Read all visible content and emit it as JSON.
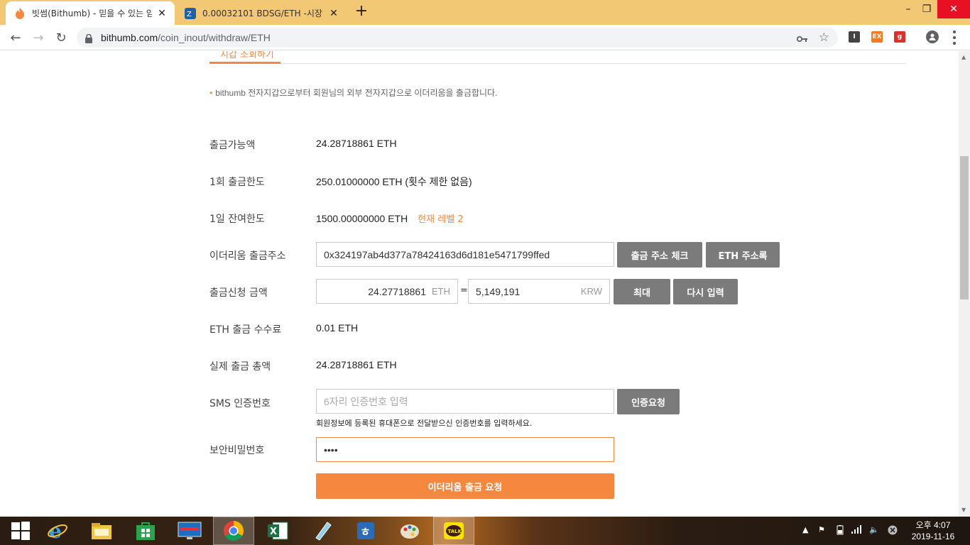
{
  "browser": {
    "tabs": [
      {
        "title": "빗썸(Bithumb) - 믿을 수 있는 암",
        "active": true
      },
      {
        "title": "0.00032101 BDSG/ETH -시장 동",
        "active": false
      }
    ],
    "url_host": "bithumb.com",
    "url_path": "/coin_inout/withdraw/ETH"
  },
  "page": {
    "subtab_label": "지갑 조회하기",
    "notice": "bithumb 전자지갑으로부터 회원님의 외부 전자지갑으로 이더리움을 출금합니다.",
    "rows": {
      "available": {
        "label": "출금가능액",
        "value": "24.28718861 ETH"
      },
      "per_limit": {
        "label": "1회 출금한도",
        "value": "250.01000000 ETH (횟수 제한 없음)"
      },
      "daily_limit": {
        "label": "1일 잔여한도",
        "value": "1500.00000000 ETH",
        "level": "현재 레벨 2"
      },
      "address": {
        "label": "이더리움 출금주소",
        "value": "0x324197ab4d377a78424163d6d181e5471799ffed",
        "check_button": "출금 주소 체크",
        "book_button": "ETH 주소록"
      },
      "amount": {
        "label": "출금신청 금액",
        "eth_value": "24.27718861",
        "eth_unit": "ETH",
        "equals": "=",
        "krw_value": "5,149,191",
        "krw_unit": "KRW",
        "max_button": "최대",
        "reset_button": "다시 입력"
      },
      "fee": {
        "label": "ETH 출금 수수료",
        "value": "0.01 ETH"
      },
      "total": {
        "label": "실제 출금 총액",
        "value": "24.28718861 ETH"
      },
      "sms": {
        "label": "SMS 인증번호",
        "placeholder": "6자리 인증번호 입력",
        "request_button": "인증요청",
        "hint": "회원정보에 등록된 휴대폰으로 전달받으신 인증번호를 입력하세요."
      },
      "password": {
        "label": "보안비밀번호",
        "value": "••••"
      }
    },
    "submit_label": "이더리움 출금 요청"
  },
  "taskbar": {
    "time": "오후 4:07",
    "date": "2019-11-16"
  },
  "colors": {
    "accent": "#f6873f",
    "button_gray": "#7b7b7b",
    "tabbar": "#f2c874"
  }
}
